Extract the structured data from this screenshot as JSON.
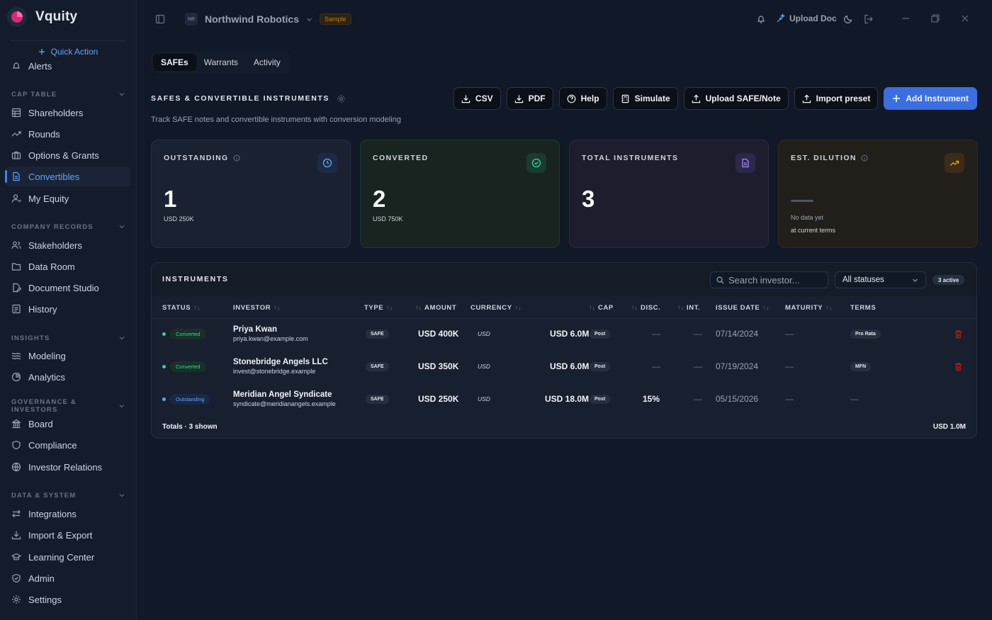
{
  "app": {
    "brand": "Vquity",
    "quick_action": "Quick Action",
    "company_initials": "NR",
    "company_name": "Northwind Robotics",
    "sample_badge": "Sample",
    "upload_doc": "Upload Doc"
  },
  "sidebar": {
    "partial_item": "Alerts",
    "sections": [
      {
        "title": "CAP TABLE",
        "items": [
          "Shareholders",
          "Rounds",
          "Options & Grants",
          "Convertibles",
          "My Equity"
        ]
      },
      {
        "title": "COMPANY RECORDS",
        "items": [
          "Stakeholders",
          "Data Room",
          "Document Studio",
          "History"
        ]
      },
      {
        "title": "INSIGHTS",
        "items": [
          "Modeling",
          "Analytics"
        ]
      },
      {
        "title": "GOVERNANCE & INVESTORS",
        "items": [
          "Board",
          "Compliance",
          "Investor Relations"
        ]
      },
      {
        "title": "DATA & SYSTEM",
        "items": [
          "Integrations",
          "Import & Export",
          "Learning Center",
          "Admin",
          "Settings"
        ]
      }
    ],
    "active_item": "Convertibles"
  },
  "tabs": [
    "SAFEs",
    "Warrants",
    "Activity"
  ],
  "active_tab": "SAFEs",
  "section": {
    "title": "SAFES & CONVERTIBLE INSTRUMENTS",
    "subtitle": "Track SAFE notes and convertible instruments with conversion modeling"
  },
  "actions": {
    "csv": "CSV",
    "pdf": "PDF",
    "help": "Help",
    "simulate": "Simulate",
    "upload": "Upload SAFE/Note",
    "import": "Import preset",
    "add": "Add Instrument"
  },
  "cards": {
    "outstanding": {
      "label": "OUTSTANDING",
      "value": "1",
      "sub": "USD 250K"
    },
    "converted": {
      "label": "CONVERTED",
      "value": "2",
      "sub": "USD 750K"
    },
    "total": {
      "label": "TOTAL INSTRUMENTS",
      "value": "3"
    },
    "dilution": {
      "label": "EST. DILUTION",
      "note1": "No data yet",
      "note2": "at current terms"
    }
  },
  "table": {
    "title": "INSTRUMENTS",
    "search_placeholder": "Search investor...",
    "status_filter": "All statuses",
    "active_count": "3 active",
    "columns": {
      "status": "STATUS",
      "investor": "INVESTOR",
      "type": "TYPE",
      "amount": "AMOUNT",
      "currency": "CURRENCY",
      "cap": "CAP",
      "disc": "DISC.",
      "int": "INT.",
      "issue_date": "ISSUE DATE",
      "maturity": "MATURITY",
      "terms": "TERMS"
    },
    "rows": [
      {
        "status": "Converted",
        "name": "Priya Kwan",
        "email": "priya.kwan@example.com",
        "type": "SAFE",
        "amount": "USD 400K",
        "currency": "USD",
        "cap": "USD 6.0M",
        "cap_type": "Post",
        "disc": "—",
        "int": "—",
        "issue_date": "07/14/2024",
        "maturity": "—",
        "terms": "Pro Rata"
      },
      {
        "status": "Converted",
        "name": "Stonebridge Angels LLC",
        "email": "invest@stonebridge.example",
        "type": "SAFE",
        "amount": "USD 350K",
        "currency": "USD",
        "cap": "USD 6.0M",
        "cap_type": "Post",
        "disc": "—",
        "int": "—",
        "issue_date": "07/19/2024",
        "maturity": "—",
        "terms": "MFN"
      },
      {
        "status": "Outstanding",
        "name": "Meridian Angel Syndicate",
        "email": "syndicate@meridianangels.example",
        "type": "SAFE",
        "amount": "USD 250K",
        "currency": "USD",
        "cap": "USD 18.0M",
        "cap_type": "Post",
        "disc": "15%",
        "int": "—",
        "issue_date": "05/15/2026",
        "maturity": "—",
        "terms": "—"
      }
    ],
    "totals_label": "Totals · 3 shown",
    "totals_value": "USD 1.0M"
  },
  "colors": {
    "accent": "#3b6fe0",
    "converted": "#34d399",
    "outstanding": "#60a5fa",
    "danger": "#b91c1c"
  }
}
